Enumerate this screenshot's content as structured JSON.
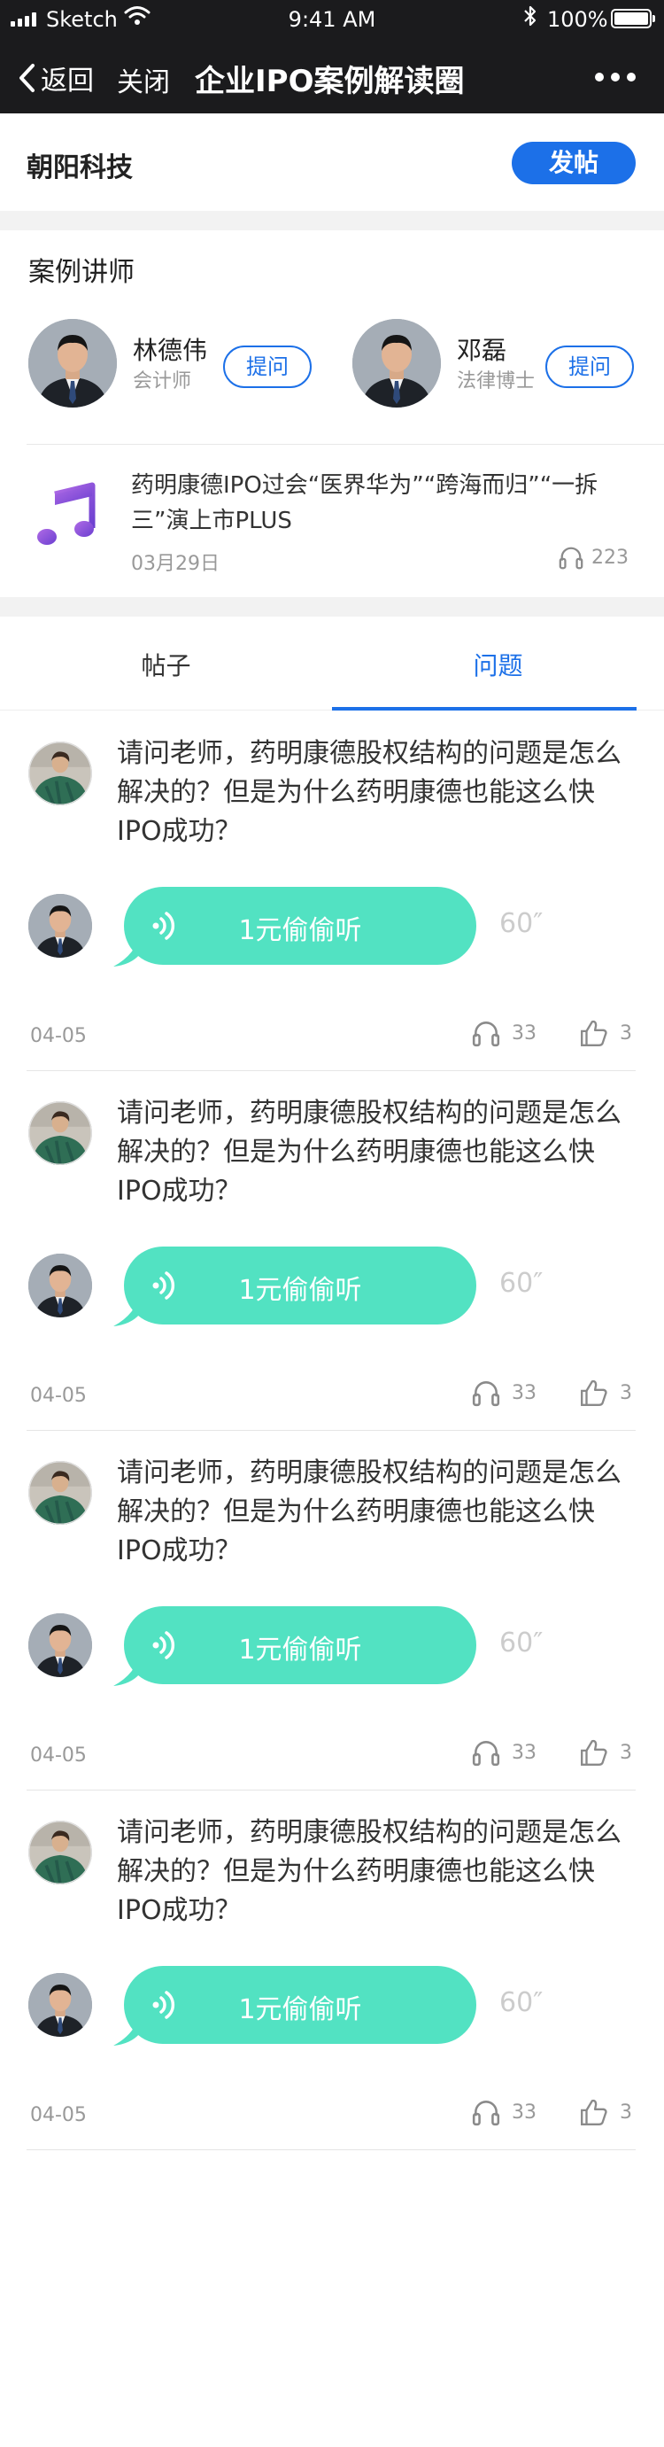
{
  "status_bar": {
    "carrier": "Sketch",
    "time": "9:41 AM",
    "battery": "100%",
    "battery_level": 1.0
  },
  "nav": {
    "back_label": "返回",
    "close_label": "关闭",
    "title": "企业IPO案例解读圈"
  },
  "company": {
    "name": "朝阳科技",
    "post_label": "发帖"
  },
  "lecturers": {
    "title": "案例讲师",
    "items": [
      {
        "name": "林德伟",
        "role": "会计师",
        "ask_label": "提问"
      },
      {
        "name": "邓磊",
        "role": "法律博士",
        "ask_label": "提问"
      }
    ]
  },
  "featured": {
    "icon": "music-note-icon",
    "title": "药明康德IPO过会“医界华为”“跨海而归”“一拆三”演上市PLUS",
    "date": "03月29日",
    "plays": "223"
  },
  "tabs": {
    "items": [
      {
        "label": "帖子",
        "active": false
      },
      {
        "label": "问题",
        "active": true
      }
    ]
  },
  "questions": [
    {
      "text": "请问老师，药明康德股权结构的问题是怎么解决的？但是为什么药明康德也能这么快IPO成功？",
      "listen_label": "1元偷偷听",
      "duration": "60″",
      "date": "04-05",
      "listens": "33",
      "likes": "3"
    },
    {
      "text": "请问老师，药明康德股权结构的问题是怎么解决的？但是为什么药明康德也能这么快IPO成功？",
      "listen_label": "1元偷偷听",
      "duration": "60″",
      "date": "04-05",
      "listens": "33",
      "likes": "3"
    },
    {
      "text": "请问老师，药明康德股权结构的问题是怎么解决的？但是为什么药明康德也能这么快IPO成功？",
      "listen_label": "1元偷偷听",
      "duration": "60″",
      "date": "04-05",
      "listens": "33",
      "likes": "3"
    },
    {
      "text": "请问老师，药明康德股权结构的问题是怎么解决的？但是为什么药明康德也能这么快IPO成功？",
      "listen_label": "1元偷偷听",
      "duration": "60″",
      "date": "04-05",
      "listens": "33",
      "likes": "3"
    }
  ],
  "colors": {
    "accent": "#1c70e8",
    "bubble": "#52e2c2",
    "nav_bg": "#1b1b1d"
  }
}
